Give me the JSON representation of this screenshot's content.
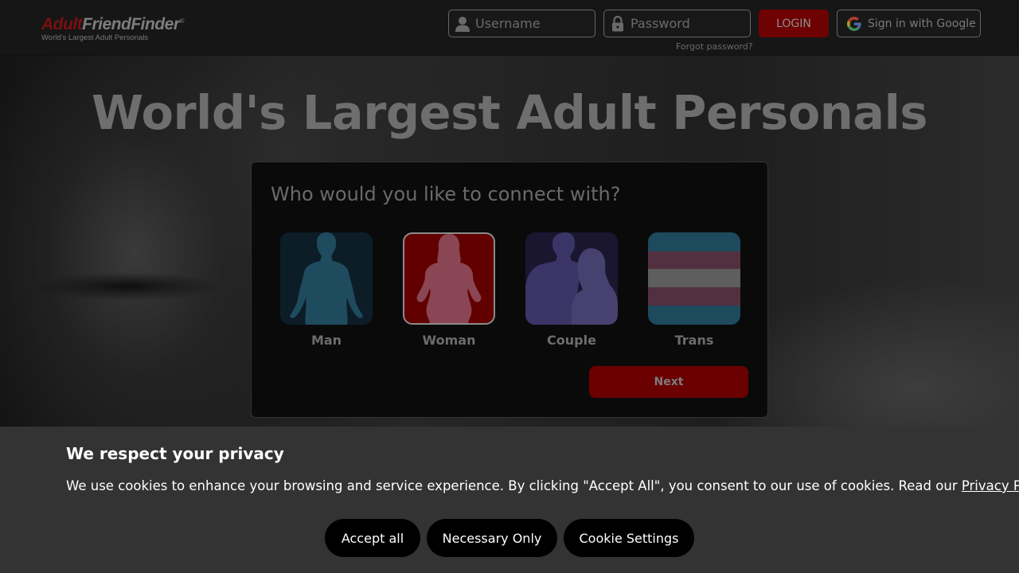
{
  "header": {
    "logo": {
      "adult": "Adult",
      "friendfinder": "FriendFinder",
      "mark": "®",
      "tagline": "World's Largest Adult Personals"
    },
    "username_placeholder": "Username",
    "password_placeholder": "Password",
    "forgot_label": "Forgot password?",
    "login_label": "LOGIN",
    "google_label": "Sign in with Google"
  },
  "hero": {
    "headline": "World's Largest Adult Personals"
  },
  "connect": {
    "title": "Who would you like to connect with?",
    "options": [
      {
        "label": "Man",
        "icon": "man-silhouette-icon",
        "selected": false
      },
      {
        "label": "Woman",
        "icon": "woman-silhouette-icon",
        "selected": true
      },
      {
        "label": "Couple",
        "icon": "couple-silhouette-icon",
        "selected": false
      },
      {
        "label": "Trans",
        "icon": "trans-flag-icon",
        "selected": false
      }
    ],
    "next_label": "Next"
  },
  "cookie": {
    "title": "We respect your privacy",
    "text": "We use cookies to enhance your browsing and service experience. By clicking \"Accept All\", you consent to our use of cookies. Read our ",
    "link": "Privacy Policy",
    "accept_label": "Accept all",
    "necessary_label": "Necessary Only",
    "settings_label": "Cookie Settings"
  },
  "colors": {
    "brand_red": "#6e0202",
    "header_bg": "#161616",
    "banner_bg": "#333333",
    "man_tile": "#0c1d27",
    "woman_tile": "#620000",
    "couple_tile": "#1a1630"
  }
}
